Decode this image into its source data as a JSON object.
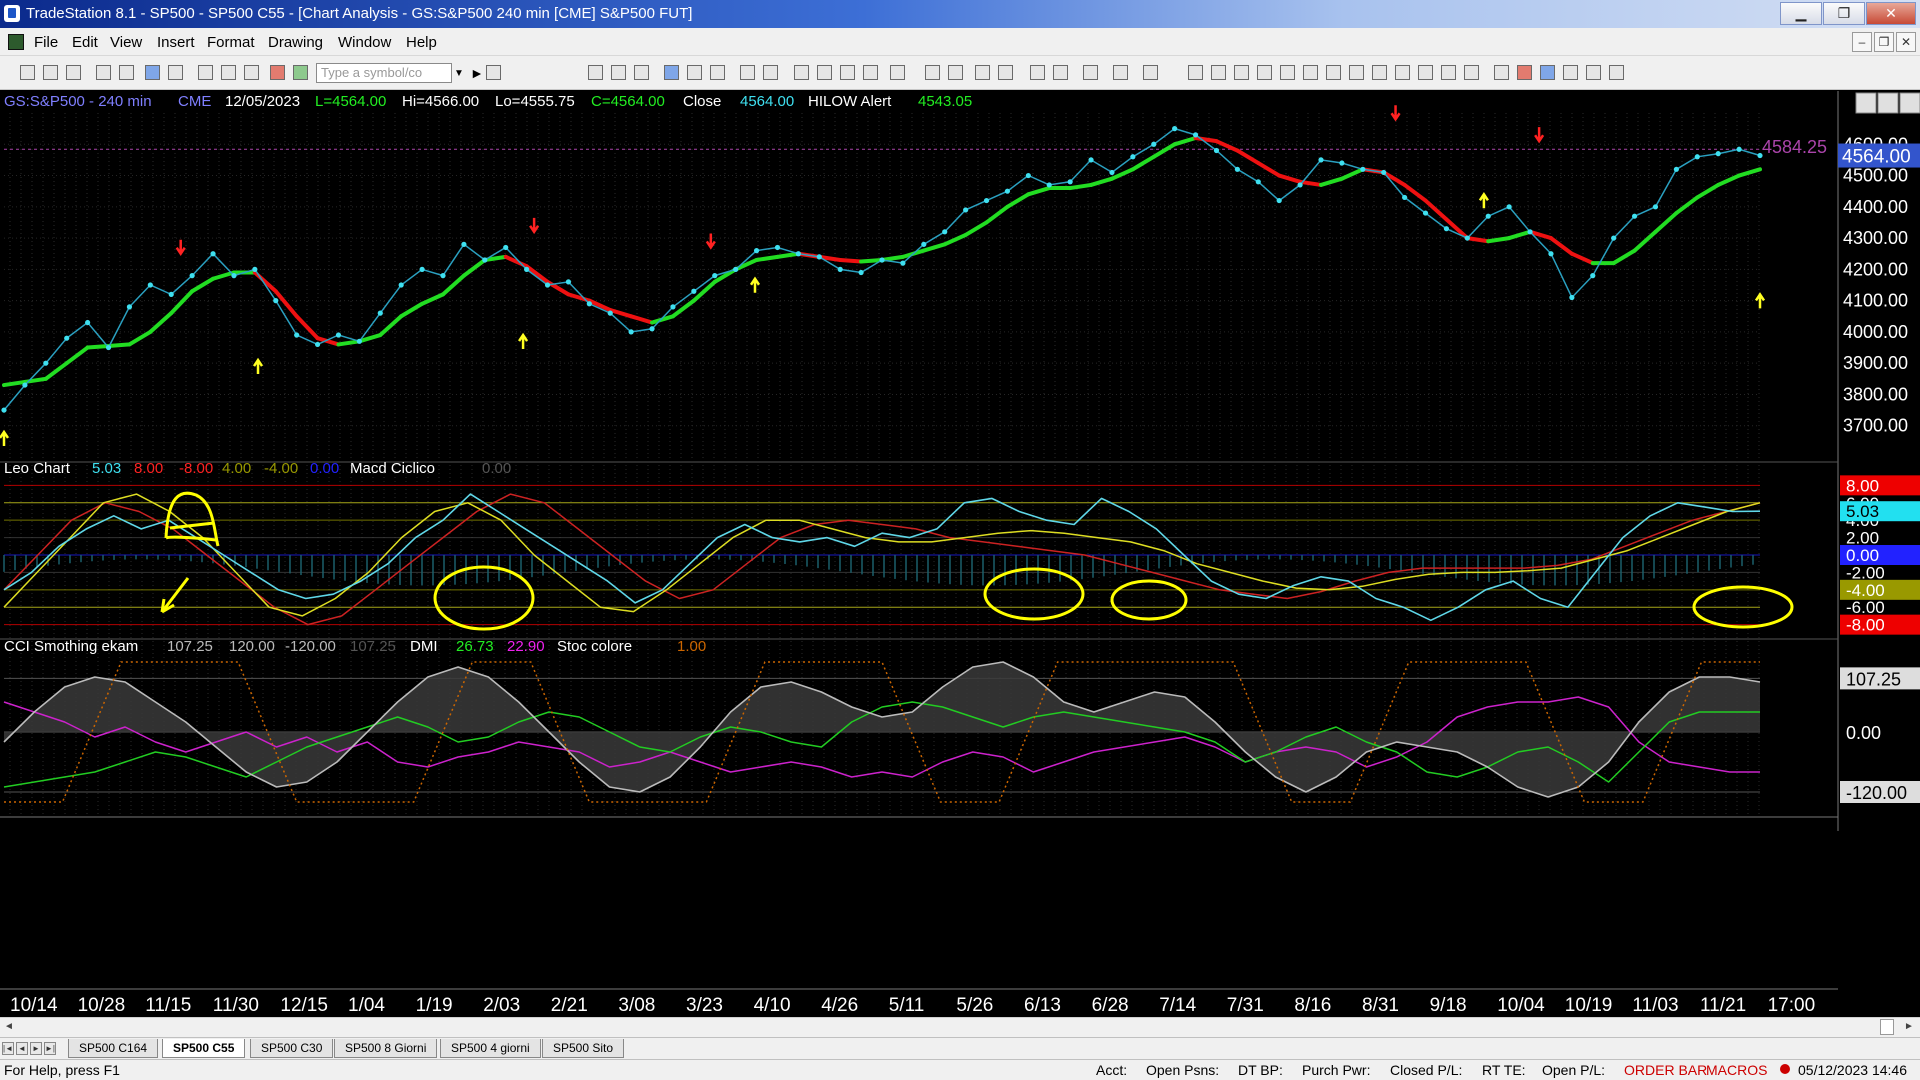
{
  "window": {
    "title": "TradeStation 8.1 - SP500 - SP500 C55 - [Chart Analysis - GS:S&P500  240 min  [CME] S&P500 FUT]",
    "minimize": "▁",
    "maximize": "❐",
    "close": "✕"
  },
  "menu": [
    "File",
    "Edit",
    "View",
    "Insert",
    "Format",
    "Drawing",
    "Window",
    "Help"
  ],
  "toolbar": {
    "symbol_placeholder": "Type a symbol/co"
  },
  "price_header": {
    "symbol": "GS:S&P500 - 240 min",
    "exchange": "CME",
    "date": "12/05/2023",
    "last": "L=4564.00",
    "high": "Hi=4566.00",
    "low": "Lo=4555.75",
    "close_val": "C=4564.00",
    "close_label": "Close",
    "close_value": "4564.00",
    "alert_label": "HILOW Alert",
    "alert_value": "4543.05"
  },
  "leo_header": {
    "name": "Leo Chart",
    "v1": "5.03",
    "v2": "8.00",
    "v3": "-8.00",
    "v4": "4.00",
    "v5": "-4.00",
    "v6": "0.00",
    "name2": "Macd Ciclico",
    "v7": "0.00"
  },
  "cci_header": {
    "name": "CCI Smothing ekam",
    "v1": "107.25",
    "v2": "120.00",
    "v3": "-120.00",
    "v4": "107.25",
    "dmi": "DMI",
    "dmi_plus": "26.73",
    "dmi_minus": "22.90",
    "stoc": "Stoc colore",
    "stoc_val": "1.00"
  },
  "chart_data": [
    {
      "type": "line",
      "title": "GS:S&P500 - 240 min",
      "ylim": [
        3600,
        4700
      ],
      "y_ticks": [
        "4600.00",
        "4500.00",
        "4400.00",
        "4300.00",
        "4200.00",
        "4100.00",
        "4000.00",
        "3900.00",
        "3800.00",
        "3700.00"
      ],
      "y_tick_values": [
        4600,
        4500,
        4400,
        4300,
        4200,
        4100,
        4000,
        3900,
        3800,
        3700
      ],
      "price_badge": "4564.00",
      "prev_high_label": "4584.25",
      "prev_high_value": 4584.25,
      "series": [
        {
          "values": [
            3750,
            3830,
            3900,
            3980,
            4030,
            3950,
            4080,
            4150,
            4120,
            4180,
            4250,
            4180,
            4200,
            4100,
            3990,
            3960,
            3990,
            3970,
            4060,
            4150,
            4200,
            4180,
            4280,
            4230,
            4270,
            4200,
            4150,
            4160,
            4090,
            4060,
            4000,
            4010,
            4080,
            4130,
            4180,
            4200,
            4260,
            4270,
            4250,
            4240,
            4200,
            4190,
            4230,
            4220,
            4280,
            4320,
            4390,
            4420,
            4450,
            4500,
            4470,
            4480,
            4550,
            4510,
            4560,
            4600,
            4650,
            4630,
            4580,
            4520,
            4480,
            4420,
            4470,
            4550,
            4540,
            4520,
            4510,
            4430,
            4380,
            4330,
            4300,
            4370,
            4400,
            4320,
            4250,
            4110,
            4180,
            4300,
            4370,
            4400,
            4520,
            4560,
            4570,
            4584,
            4564
          ]
        },
        {
          "values": [
            3830,
            3840,
            3850,
            3900,
            3950,
            3955,
            3960,
            4000,
            4060,
            4130,
            4170,
            4190,
            4190,
            4130,
            4050,
            3980,
            3960,
            3970,
            3990,
            4050,
            4090,
            4120,
            4180,
            4230,
            4240,
            4210,
            4160,
            4120,
            4100,
            4070,
            4050,
            4030,
            4050,
            4100,
            4160,
            4200,
            4230,
            4240,
            4250,
            4240,
            4230,
            4225,
            4230,
            4240,
            4260,
            4280,
            4310,
            4350,
            4400,
            4440,
            4460,
            4460,
            4470,
            4490,
            4520,
            4560,
            4600,
            4620,
            4610,
            4580,
            4540,
            4500,
            4480,
            4470,
            4490,
            4520,
            4510,
            4470,
            4420,
            4360,
            4300,
            4290,
            4300,
            4320,
            4300,
            4250,
            4220,
            4220,
            4260,
            4320,
            4380,
            4430,
            4470,
            4500,
            4520
          ]
        }
      ],
      "signals_down": [
        [
          16,
          4250
        ],
        [
          48,
          4320
        ],
        [
          64,
          4270
        ],
        [
          126,
          4680
        ],
        [
          139,
          4610
        ]
      ],
      "signals_up": [
        [
          0,
          3680
        ],
        [
          23,
          3910
        ],
        [
          47,
          3990
        ],
        [
          68,
          4170
        ],
        [
          134,
          4440
        ],
        [
          159,
          4120
        ]
      ]
    },
    {
      "type": "line",
      "title": "Leo Chart / Macd Ciclico",
      "ylim": [
        -8.5,
        8.5
      ],
      "y_ticks": [
        "8.00",
        "6.00",
        "4.00",
        "2.00",
        "0.00",
        "-2.00",
        "-4.00",
        "-6.00",
        "-8.00"
      ],
      "y_tick_values": [
        8,
        6,
        4,
        2,
        0,
        -2,
        -4,
        -6,
        -8
      ],
      "last_value": "5.03",
      "series": [
        {
          "values": [
            -4,
            -2,
            1,
            3,
            4.5,
            3,
            4,
            2,
            0,
            -2,
            -4,
            -5,
            -4.5,
            -3,
            -1,
            2,
            4,
            7,
            5,
            3,
            1,
            -1,
            -3,
            -5.5,
            -4,
            -1,
            2,
            3.5,
            2,
            1.5,
            2,
            1,
            2.5,
            2,
            3,
            6,
            6.5,
            5,
            4,
            3.5,
            6.5,
            5,
            3,
            0,
            -3,
            -4.5,
            -5,
            -3.5,
            -2.5,
            -3,
            -5,
            -6,
            -7.5,
            -6,
            -4,
            -3,
            -5,
            -6,
            -2,
            2,
            4.5,
            6,
            5.5,
            5,
            5.03
          ]
        },
        {
          "values": [
            -6,
            -2,
            2,
            6,
            7,
            5,
            2,
            -2,
            -6,
            -7,
            -5,
            -2,
            2,
            5,
            6,
            4,
            0,
            -3,
            -6,
            -6.5,
            -4,
            -1,
            2,
            4,
            4,
            3,
            2,
            1.5,
            1.5,
            2,
            2.5,
            2.8,
            2.5,
            2,
            1.5,
            0.5,
            -1,
            -2,
            -3,
            -3.8,
            -4,
            -3.6,
            -2.8,
            -2.2,
            -2,
            -2,
            -1.8,
            -1.5,
            -0.5,
            0.5,
            2,
            3.5,
            5,
            6
          ]
        },
        {
          "values": [
            -4,
            0,
            4,
            6,
            5,
            3,
            0,
            -3,
            -6,
            -8,
            -7,
            -4,
            -1,
            2,
            5,
            7,
            6,
            3,
            0,
            -3,
            -5,
            -4,
            -1,
            2,
            3.5,
            4,
            3.5,
            3,
            2,
            1.5,
            1,
            0.5,
            0,
            -1,
            -2,
            -3,
            -4,
            -4.5,
            -5,
            -4.2,
            -3,
            -2,
            -1.5,
            -1.5,
            -1.5,
            -1.5,
            -1.2,
            -0.5,
            1,
            2.5,
            4,
            5,
            6
          ]
        }
      ],
      "highlighted_peaks": 5
    },
    {
      "type": "line",
      "title": "CCI Smothing ekam / DMI / Stoc colore",
      "ylim": [
        -150,
        150
      ],
      "y_ticks": [
        "107.25",
        "0.00",
        "-120.00"
      ],
      "y_tick_values": [
        107.25,
        0,
        -120
      ],
      "series": [
        {
          "values": [
            -20,
            40,
            90,
            110,
            100,
            60,
            20,
            -30,
            -80,
            -110,
            -100,
            -60,
            0,
            60,
            110,
            130,
            110,
            60,
            0,
            -60,
            -110,
            -120,
            -90,
            -30,
            40,
            90,
            100,
            80,
            50,
            30,
            40,
            90,
            130,
            140,
            110,
            60,
            40,
            60,
            80,
            70,
            20,
            -40,
            -90,
            -120,
            -90,
            -40,
            -20,
            -30,
            -40,
            -70,
            -110,
            -130,
            -110,
            -60,
            20,
            80,
            110,
            110,
            100
          ]
        },
        {
          "values": [
            60,
            40,
            20,
            -10,
            10,
            -20,
            -40,
            -20,
            0,
            -30,
            -10,
            -40,
            -20,
            -60,
            -70,
            -50,
            -40,
            -20,
            -30,
            -40,
            -70,
            -60,
            -40,
            -60,
            -80,
            -70,
            -60,
            -70,
            -90,
            -80,
            -90,
            -60,
            -40,
            -50,
            -80,
            -60,
            -40,
            -30,
            -20,
            -10,
            -30,
            -60,
            -40,
            -30,
            -40,
            -70,
            -50,
            -20,
            30,
            50,
            60,
            60,
            70,
            50,
            -20,
            -60,
            -70,
            -80,
            -80
          ]
        },
        {
          "values": [
            -110,
            -100,
            -90,
            -80,
            -60,
            -40,
            -50,
            -70,
            -90,
            -60,
            -30,
            -10,
            10,
            30,
            10,
            -20,
            -10,
            20,
            40,
            30,
            0,
            -30,
            -40,
            -10,
            10,
            0,
            -20,
            -30,
            20,
            50,
            60,
            50,
            30,
            10,
            30,
            40,
            30,
            20,
            10,
            0,
            -20,
            -60,
            -40,
            -10,
            10,
            -20,
            -40,
            -80,
            -90,
            -70,
            -40,
            -30,
            -60,
            -100,
            -40,
            20,
            40,
            40,
            40
          ]
        }
      ]
    }
  ],
  "x_axis": {
    "labels": [
      "10/14",
      "10/28",
      "11/15",
      "11/30",
      "12/15",
      "1/04",
      "1/19",
      "2/03",
      "2/21",
      "3/08",
      "3/23",
      "4/10",
      "4/26",
      "5/11",
      "5/26",
      "6/13",
      "6/28",
      "7/14",
      "7/31",
      "8/16",
      "8/31",
      "9/18",
      "10/04",
      "10/19",
      "11/03",
      "11/21",
      "17:00"
    ]
  },
  "tabs": [
    "SP500 C164",
    "SP500 C55",
    "SP500 C30",
    "SP500 8 Giorni",
    "SP500 4 giorni",
    "SP500 Sito"
  ],
  "active_tab": 1,
  "status": {
    "help": "For Help, press F1",
    "acct": "Acct:",
    "open_psns": "Open Psns:",
    "dt_bp": "DT BP:",
    "purch_pwr": "Purch Pwr:",
    "closed_pl": "Closed P/L:",
    "rt_te": "RT TE:",
    "open_pl": "Open P/L:",
    "order_bar": "ORDER BAR",
    "macros": "MACROS",
    "datetime": "05/12/2023 14:46"
  },
  "colors": {
    "price_dots": "#3fe0f0",
    "ma_up": "#22dd22",
    "ma_down": "#ee1111",
    "leo_line": "#5fd7e8",
    "red_wave": "#cc2222",
    "yellow_wave": "#dddd22",
    "cci": "#bbbbbb",
    "dmi_plus": "#22cc22",
    "dmi_minus": "#cc22cc",
    "stoc": "#cc6600",
    "annotation": "#ffff00"
  }
}
